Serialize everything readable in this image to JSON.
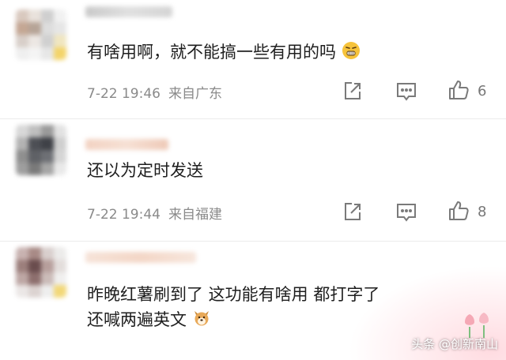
{
  "comments": [
    {
      "text": "有啥用啊，就不能搞一些有用的吗",
      "emoji": "grimace-face",
      "time": "7-22 19:46",
      "location": "来自广东",
      "likes": "6"
    },
    {
      "text": "还以为定时发送",
      "time": "7-22 19:44",
      "location": "来自福建",
      "likes": "8"
    },
    {
      "text_line1": "昨晚红薯刷到了 这功能有啥用 都打字了",
      "text_line2": "还喊两遍英文",
      "emoji": "dog-face"
    }
  ],
  "watermark": "头条 @创新南山",
  "colors": {
    "meta_text": "#8a8a8a",
    "icon_stroke": "#7a7a7a",
    "emoji_yellow": "#f6c33b",
    "accent_pink": "#f8c8cf"
  }
}
